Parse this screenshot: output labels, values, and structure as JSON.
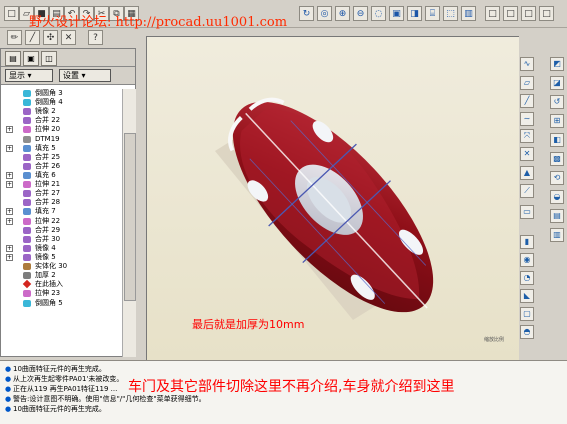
{
  "watermark": "野火设计论坛: http://procad.uu1001.com",
  "toolbar": {
    "top_buttons": [
      "new-icon",
      "open-icon",
      "save-icon",
      "print-icon",
      "undo-icon",
      "redo-icon",
      "cut-icon",
      "copy-icon",
      "paste-icon",
      "regen-icon",
      "zoom-fit-icon",
      "zoom-in-icon",
      "zoom-out-icon",
      "repaint-icon",
      "view-icon",
      "display-icon",
      "layer-icon",
      "close-icon"
    ],
    "second_buttons": [
      "sketch-icon",
      "plane-icon",
      "axis-icon",
      "point-icon",
      "help-arrow-icon"
    ]
  },
  "left_panel": {
    "tabs": [
      "model-tree-tab",
      "folder-tab",
      "layer-tab"
    ],
    "dropdown_display": "显示 ▾",
    "dropdown_settings": "设置 ▾",
    "tree_items": [
      {
        "label": "倒圆角 3",
        "icon": "round-icon"
      },
      {
        "label": "倒圆角 4",
        "icon": "round-icon"
      },
      {
        "label": "镜像 2",
        "icon": "mirror-icon"
      },
      {
        "label": "合并 22",
        "icon": "merge-icon"
      },
      {
        "label": "拉伸 20",
        "icon": "extrude-icon"
      },
      {
        "label": "DTM19",
        "icon": "datum-icon"
      },
      {
        "label": "填充 5",
        "icon": "fill-icon"
      },
      {
        "label": "合并 25",
        "icon": "merge-icon"
      },
      {
        "label": "合并 26",
        "icon": "merge-icon"
      },
      {
        "label": "填充 6",
        "icon": "fill-icon"
      },
      {
        "label": "拉伸 21",
        "icon": "extrude-icon"
      },
      {
        "label": "合并 27",
        "icon": "merge-icon"
      },
      {
        "label": "合并 28",
        "icon": "merge-icon"
      },
      {
        "label": "填充 7",
        "icon": "fill-icon"
      },
      {
        "label": "拉伸 22",
        "icon": "extrude-icon"
      },
      {
        "label": "合并 29",
        "icon": "merge-icon"
      },
      {
        "label": "合并 30",
        "icon": "merge-icon"
      },
      {
        "label": "镜像 4",
        "icon": "mirror-icon"
      },
      {
        "label": "镜像 5",
        "icon": "mirror-icon"
      },
      {
        "label": "实体化 30",
        "icon": "solidify-icon"
      },
      {
        "label": "加厚 2",
        "icon": "thicken-icon"
      },
      {
        "label": "在此插入",
        "icon": "insert-icon"
      },
      {
        "label": "拉伸 23",
        "icon": "extrude-icon"
      },
      {
        "label": "倒圆角 5",
        "icon": "round-icon"
      }
    ]
  },
  "viewport": {
    "caption": "最后就是加厚为10mm",
    "car_color": "#8f0f18",
    "scale_label": "缩放比例"
  },
  "messages": [
    "10曲面特征元件的再生完成。",
    "从上次再生起零件PA01'未被改变。",
    "正在从119 再生PA01特征119 ...",
    "警告:设计意图不明确。使用\"信息\"/\"几何检查\"菜单获得细节。",
    "10曲面特征元件的再生完成。"
  ],
  "bottom_caption": "车门及其它部件切除这里不再介绍,车身就介绍到这里",
  "right_tools": [
    "sketch-icon",
    "plane-icon",
    "axis-icon",
    "curve-icon",
    "csys-icon",
    "analysis-icon",
    "mirror-icon",
    "extrude-icon",
    "revolve-icon",
    "sweep-icon",
    "blend-icon",
    "round-icon",
    "chamfer-icon",
    "hole-icon",
    "shell-icon"
  ],
  "side_tools": [
    "view-icon",
    "zoom-icon",
    "spin-icon",
    "orient-icon",
    "display-icon",
    "hidden-icon",
    "wire-icon",
    "shade-icon",
    "layer-icon",
    "saved-view-icon"
  ]
}
